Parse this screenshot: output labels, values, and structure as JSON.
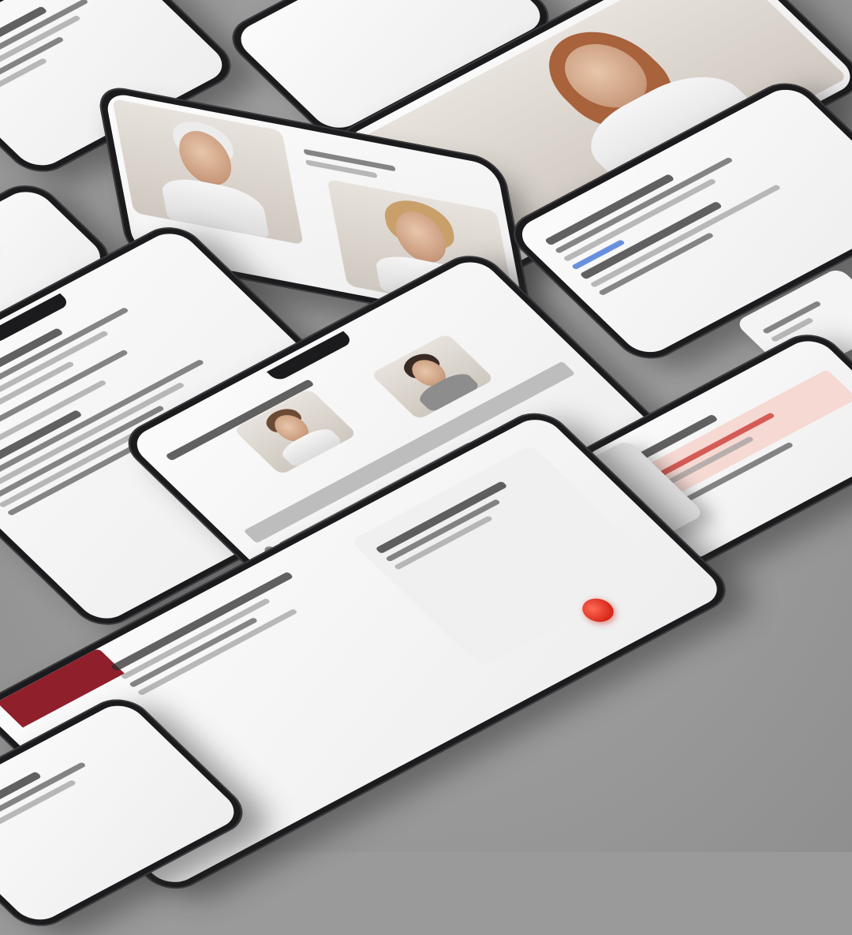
{
  "colors": {
    "background": "#9b9b9b",
    "phone_frame": "#1b1b1d",
    "screen": "#f4f4f4",
    "accent_red": "#c9302c",
    "accent_maroon": "#8e1f2b"
  },
  "icons": [
    "record-button-icon",
    "status-icons",
    "list-bullet-icon"
  ]
}
